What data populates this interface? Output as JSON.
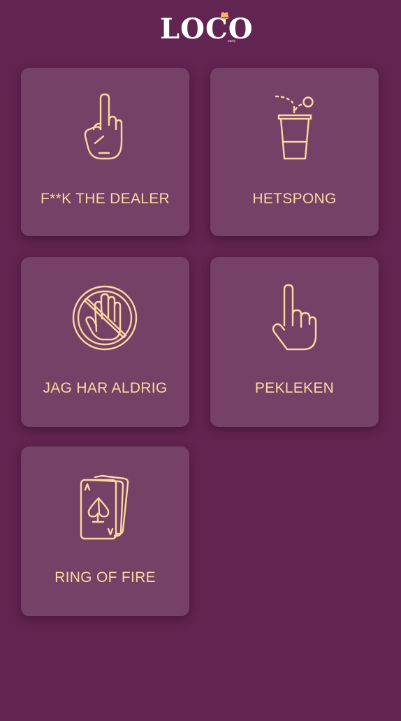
{
  "brand": {
    "name": "LOCO",
    "sub": "party"
  },
  "games": [
    {
      "label": "F**K THE DEALER",
      "icon": "middle-finger-icon"
    },
    {
      "label": "HETSPONG",
      "icon": "beer-pong-cup-icon"
    },
    {
      "label": "JAG HAR ALDRIG",
      "icon": "no-hand-icon"
    },
    {
      "label": "PEKLEKEN",
      "icon": "pointing-hand-icon"
    },
    {
      "label": "RING OF FIRE",
      "icon": "playing-cards-icon"
    }
  ],
  "colors": {
    "background": "#622450",
    "card": "#774167",
    "accent": "#fdd7a0"
  }
}
